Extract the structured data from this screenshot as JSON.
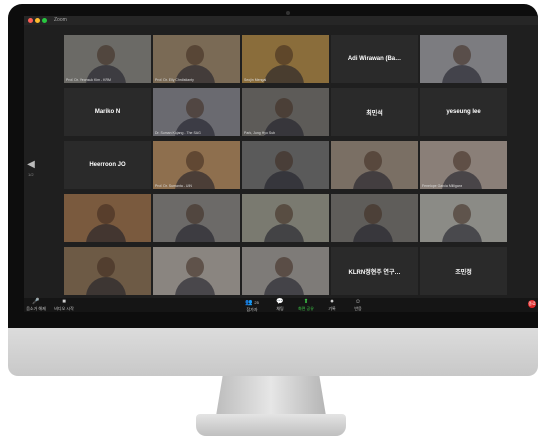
{
  "window": {
    "title": "Zoom"
  },
  "participants": [
    {
      "id": 1,
      "label": "Prof. Dr. Yeonsuk Kim - KRM",
      "name": "",
      "bg": "#6b6a66"
    },
    {
      "id": 2,
      "label": "Prof. Dr. Elly Chrdistianty",
      "name": "",
      "bg": "#7a6a55"
    },
    {
      "id": 3,
      "label": "Seojin Mengal",
      "name": "",
      "bg": "#8a6d3b"
    },
    {
      "id": 4,
      "label": "",
      "name": "Adi Wirawan (Ba…",
      "bg": "#2a2a2a"
    },
    {
      "id": 5,
      "label": "",
      "name": "",
      "bg": "#7c7c80"
    },
    {
      "id": 6,
      "label": "",
      "name": "Mariko N",
      "bg": "#2a2a2a"
    },
    {
      "id": 7,
      "label": "Dr. Suman Kujang - The SAG",
      "name": "",
      "bg": "#6a6a70"
    },
    {
      "id": 8,
      "label": "Park, Jung Hyo Sub",
      "name": "",
      "bg": "#5d5b58"
    },
    {
      "id": 9,
      "label": "",
      "name": "최민석",
      "bg": "#2a2a2a"
    },
    {
      "id": 10,
      "label": "",
      "name": "yeseung lee",
      "bg": "#2a2a2a"
    },
    {
      "id": 11,
      "label": "",
      "name": "Heerroon JO",
      "bg": "#2a2a2a"
    },
    {
      "id": 12,
      "label": "Prof. Dr. Sumanta - UIN",
      "name": "",
      "bg": "#8e6f4e"
    },
    {
      "id": 13,
      "label": "",
      "name": "",
      "bg": "#5a5a5a"
    },
    {
      "id": 14,
      "label": "",
      "name": "",
      "bg": "#7a6f64"
    },
    {
      "id": 15,
      "label": "Fenelope Garcia Milligans",
      "name": "",
      "bg": "#8a7f78"
    },
    {
      "id": 16,
      "label": "",
      "name": "",
      "bg": "#7a5a3e"
    },
    {
      "id": 17,
      "label": "",
      "name": "",
      "bg": "#6c6a68"
    },
    {
      "id": 18,
      "label": "",
      "name": "",
      "bg": "#7a7a70"
    },
    {
      "id": 19,
      "label": "",
      "name": "",
      "bg": "#5f5d5a"
    },
    {
      "id": 20,
      "label": "",
      "name": "",
      "bg": "#8b8b86"
    },
    {
      "id": 21,
      "label": "",
      "name": "",
      "bg": "#6d5a45"
    },
    {
      "id": 22,
      "label": "",
      "name": "",
      "bg": "#8a8580"
    },
    {
      "id": 23,
      "label": "",
      "name": "",
      "bg": "#7e7b78"
    },
    {
      "id": 24,
      "label": "",
      "name": "KLRN정현주 연구…",
      "bg": "#2a2a2a"
    },
    {
      "id": 25,
      "label": "",
      "name": "조민정",
      "bg": "#2a2a2a"
    }
  ],
  "toolbar": {
    "mute_label": "음소거 해제",
    "video_label": "비디오 시작",
    "participants_label": "참가자",
    "participants_count": "25",
    "chat_label": "채팅",
    "share_label": "화면 공유",
    "record_label": "기록",
    "reactions_label": "반응",
    "end_label": "종료"
  },
  "nav": {
    "left_page": "1/2",
    "right_page": "1/2"
  },
  "colors": {
    "active_speaker": "#3fd04a",
    "end_button": "#e02828"
  }
}
